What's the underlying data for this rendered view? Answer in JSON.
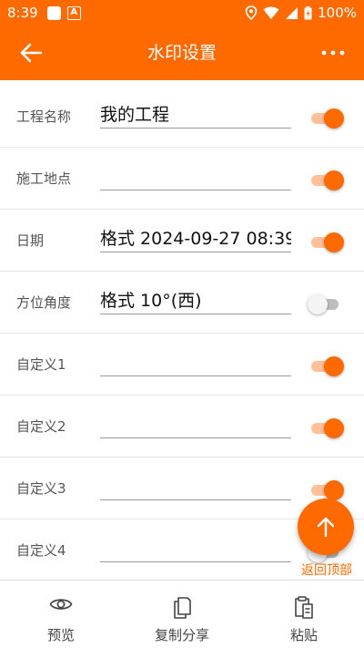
{
  "status_bar": {
    "time": "8:39",
    "notif_a_glyph": "A",
    "battery_pct": "100%"
  },
  "app_bar": {
    "title": "水印设置",
    "back_icon": "arrow-left-icon",
    "more_icon": "more-horizontal-icon"
  },
  "rows": [
    {
      "label": "工程名称",
      "value": "我的工程",
      "enabled": true
    },
    {
      "label": "施工地点",
      "value": "",
      "enabled": true
    },
    {
      "label": "日期",
      "value": "格式 2024-09-27 08:39:3",
      "enabled": true
    },
    {
      "label": "方位角度",
      "value": "格式 10°(西)",
      "enabled": false
    },
    {
      "label": "自定义1",
      "value": "",
      "enabled": true
    },
    {
      "label": "自定义2",
      "value": "",
      "enabled": true
    },
    {
      "label": "自定义3",
      "value": "",
      "enabled": true
    },
    {
      "label": "自定义4",
      "value": "",
      "enabled": false
    }
  ],
  "fab": {
    "label": "返回顶部",
    "icon": "arrow-up-icon"
  },
  "bottom_nav": [
    {
      "label": "预览",
      "icon": "eye-icon"
    },
    {
      "label": "复制分享",
      "icon": "copy-icon"
    },
    {
      "label": "粘贴",
      "icon": "paste-icon"
    }
  ],
  "colors": {
    "accent": "#ff6a00",
    "accent_light": "#ffbf99",
    "divider": "#e6e6e6"
  }
}
